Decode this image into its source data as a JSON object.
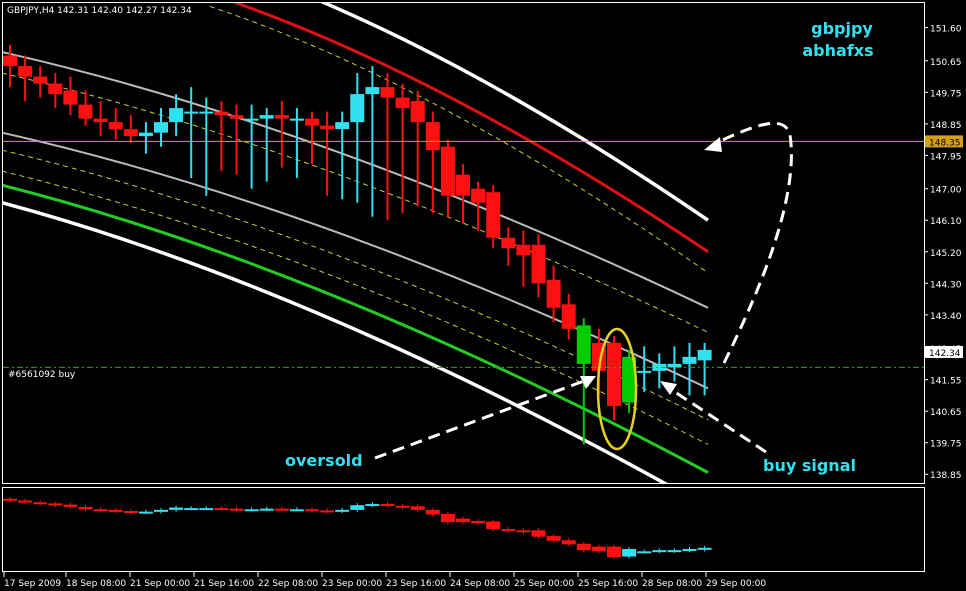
{
  "window": {
    "header": "GBPJPY,H4  142.31 142.40 142.27 142.34"
  },
  "annotations": {
    "brand_line1": "gbpjpy",
    "brand_line2": "abhafxs",
    "oversold": "oversold",
    "buy_signal": "buy signal",
    "order_label": "#6561092 buy"
  },
  "colors": {
    "background": "#000000",
    "bull": "#33e0f0",
    "bear": "#ff1010",
    "bull_bar_signal": "#00cc00",
    "upper_band": "#dd1111",
    "lower_band": "#22cc22",
    "outer_band": "#ffffff",
    "middle_band": "#bbbbbb",
    "dashed_band": "#cccc33",
    "current_price_line": "#d4a017",
    "order_line": "#22aa22",
    "annotation_text": "#33e0f0",
    "ellipse": "#e8d020"
  },
  "chart_data": [
    {
      "type": "candlestick",
      "symbol": "GBPJPY",
      "timeframe": "H4",
      "last_ohlc": {
        "open": 142.31,
        "high": 142.4,
        "low": 142.27,
        "close": 142.34
      },
      "current_price": 142.34,
      "marked_price": 148.35,
      "order": {
        "label": "#6561092 buy",
        "price": 141.9
      },
      "ylim": [
        138.6,
        152.3
      ],
      "y_ticks": [
        "151.60",
        "150.65",
        "149.75",
        "148.85",
        "147.95",
        "147.00",
        "146.10",
        "145.20",
        "144.30",
        "143.40",
        "142.45",
        "141.55",
        "140.65",
        "139.75",
        "138.85"
      ],
      "x_ticks": [
        "17 Sep 2009",
        "18 Sep 08:00",
        "21 Sep 00:00",
        "21 Sep 16:00",
        "22 Sep 08:00",
        "23 Sep 00:00",
        "23 Sep 16:00",
        "24 Sep 08:00",
        "25 Sep 00:00",
        "25 Sep 16:00",
        "28 Sep 08:00",
        "29 Sep 00:00"
      ],
      "candles": [
        {
          "o": 150.8,
          "h": 151.1,
          "l": 149.9,
          "c": 150.5
        },
        {
          "o": 150.5,
          "h": 150.8,
          "l": 149.5,
          "c": 150.2
        },
        {
          "o": 150.2,
          "h": 150.5,
          "l": 149.6,
          "c": 150.0
        },
        {
          "o": 150.0,
          "h": 150.3,
          "l": 149.3,
          "c": 149.7
        },
        {
          "o": 149.8,
          "h": 150.2,
          "l": 149.1,
          "c": 149.4
        },
        {
          "o": 149.4,
          "h": 149.8,
          "l": 148.8,
          "c": 149.0
        },
        {
          "o": 149.0,
          "h": 149.5,
          "l": 148.5,
          "c": 148.9
        },
        {
          "o": 148.9,
          "h": 149.3,
          "l": 148.4,
          "c": 148.7
        },
        {
          "o": 148.7,
          "h": 149.1,
          "l": 148.3,
          "c": 148.5
        },
        {
          "o": 148.5,
          "h": 148.9,
          "l": 148.0,
          "c": 148.6
        },
        {
          "o": 148.6,
          "h": 149.3,
          "l": 148.2,
          "c": 148.9
        },
        {
          "o": 148.9,
          "h": 149.7,
          "l": 148.5,
          "c": 149.3
        },
        {
          "o": 149.2,
          "h": 149.9,
          "l": 147.3,
          "c": 149.2
        },
        {
          "o": 149.2,
          "h": 149.6,
          "l": 146.8,
          "c": 149.2
        },
        {
          "o": 149.2,
          "h": 149.5,
          "l": 147.5,
          "c": 149.1
        },
        {
          "o": 149.1,
          "h": 149.4,
          "l": 147.4,
          "c": 149.0
        },
        {
          "o": 149.0,
          "h": 149.4,
          "l": 147.0,
          "c": 149.0
        },
        {
          "o": 149.0,
          "h": 149.3,
          "l": 147.2,
          "c": 149.1
        },
        {
          "o": 149.1,
          "h": 149.5,
          "l": 147.6,
          "c": 149.0
        },
        {
          "o": 149.0,
          "h": 149.3,
          "l": 147.3,
          "c": 149.0
        },
        {
          "o": 149.0,
          "h": 149.2,
          "l": 147.7,
          "c": 148.8
        },
        {
          "o": 148.8,
          "h": 149.2,
          "l": 146.8,
          "c": 148.7
        },
        {
          "o": 148.7,
          "h": 149.2,
          "l": 146.7,
          "c": 148.9
        },
        {
          "o": 148.9,
          "h": 150.3,
          "l": 146.6,
          "c": 149.7
        },
        {
          "o": 149.7,
          "h": 150.5,
          "l": 146.2,
          "c": 149.9
        },
        {
          "o": 149.9,
          "h": 150.3,
          "l": 146.1,
          "c": 149.6
        },
        {
          "o": 149.6,
          "h": 150.0,
          "l": 146.3,
          "c": 149.3
        },
        {
          "o": 149.5,
          "h": 149.8,
          "l": 146.5,
          "c": 148.9
        },
        {
          "o": 148.9,
          "h": 149.2,
          "l": 146.3,
          "c": 148.1
        },
        {
          "o": 148.2,
          "h": 148.4,
          "l": 146.2,
          "c": 146.8
        },
        {
          "o": 147.4,
          "h": 147.7,
          "l": 146.0,
          "c": 146.8
        },
        {
          "o": 147.0,
          "h": 147.2,
          "l": 145.8,
          "c": 146.6
        },
        {
          "o": 146.9,
          "h": 147.1,
          "l": 145.3,
          "c": 145.6
        },
        {
          "o": 145.6,
          "h": 145.9,
          "l": 144.8,
          "c": 145.3
        },
        {
          "o": 145.4,
          "h": 145.8,
          "l": 144.2,
          "c": 145.1
        },
        {
          "o": 145.4,
          "h": 145.7,
          "l": 143.9,
          "c": 144.3
        },
        {
          "o": 144.4,
          "h": 144.8,
          "l": 143.2,
          "c": 143.6
        },
        {
          "o": 143.7,
          "h": 144.0,
          "l": 142.7,
          "c": 143.0
        },
        {
          "o": 143.1,
          "h": 143.3,
          "l": 139.7,
          "c": 142.0
        },
        {
          "o": 142.6,
          "h": 143.0,
          "l": 141.1,
          "c": 141.8
        },
        {
          "o": 142.6,
          "h": 142.8,
          "l": 140.4,
          "c": 140.8
        },
        {
          "o": 140.9,
          "h": 142.4,
          "l": 140.6,
          "c": 142.2
        },
        {
          "o": 141.8,
          "h": 142.5,
          "l": 141.2,
          "c": 141.8
        },
        {
          "o": 141.8,
          "h": 142.3,
          "l": 141.3,
          "c": 142.0
        },
        {
          "o": 141.9,
          "h": 142.5,
          "l": 141.5,
          "c": 142.0
        },
        {
          "o": 142.0,
          "h": 142.6,
          "l": 141.1,
          "c": 142.2
        },
        {
          "o": 142.1,
          "h": 142.6,
          "l": 141.1,
          "c": 142.4
        }
      ],
      "bands": {
        "outer_upper_white": {
          "x0": 205,
          "x1": 708,
          "start": 153.6,
          "end": 146.1
        },
        "upper_red": {
          "x0": 195,
          "x1": 708,
          "start": 152.7,
          "end": 145.2
        },
        "upper_dashed": {
          "x0": 210,
          "x1": 708,
          "start": 152.2,
          "end": 144.6
        },
        "middle_upper_gray": {
          "x0": 2,
          "x1": 708,
          "start": 150.9,
          "end": 143.6
        },
        "middle_dashed": {
          "x0": 2,
          "x1": 708,
          "start": 150.3,
          "end": 142.9
        },
        "middle_gray": {
          "x0": 2,
          "x1": 708,
          "start": 148.6,
          "end": 141.3
        },
        "lower_dashed_1": {
          "x0": 2,
          "x1": 708,
          "start": 148.1,
          "end": 140.4
        },
        "lower_dashed_2": {
          "x0": 2,
          "x1": 708,
          "start": 147.5,
          "end": 139.7
        },
        "lower_green": {
          "x0": 2,
          "x1": 708,
          "start": 147.1,
          "end": 138.9
        },
        "outer_lower_white": {
          "x0": 2,
          "x1": 708,
          "start": 146.6,
          "end": 137.9
        }
      }
    },
    {
      "type": "bar",
      "panel": "sub-indicator",
      "values_by_candle": "same_candles_compressed"
    }
  ]
}
